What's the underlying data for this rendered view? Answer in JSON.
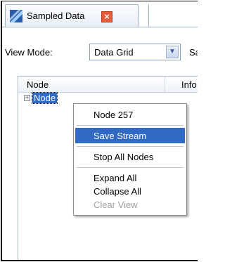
{
  "window": {
    "tab_title": "Sampled Data",
    "tab_icon": "sampled-data-icon",
    "close_icon": "close-icon"
  },
  "toolbar": {
    "view_mode_label": "View Mode:",
    "view_mode_value": "Data Grid",
    "next_label_partial": "Sa"
  },
  "grid": {
    "columns": [
      "Node",
      "Info"
    ],
    "rows": [
      {
        "label": "Node",
        "expander": "+"
      }
    ]
  },
  "context_menu": {
    "items": [
      {
        "label": "Node 257",
        "state": "normal"
      },
      {
        "label": "Save Stream",
        "state": "highlighted"
      },
      {
        "label": "Stop All Nodes",
        "state": "normal"
      },
      {
        "label": "Expand All",
        "state": "normal"
      },
      {
        "label": "Collapse All",
        "state": "normal"
      },
      {
        "label": "Clear View",
        "state": "disabled"
      }
    ]
  },
  "colors": {
    "selection": "#316ac5",
    "close_button": "#e85c3a",
    "border": "#9fb1cc"
  }
}
